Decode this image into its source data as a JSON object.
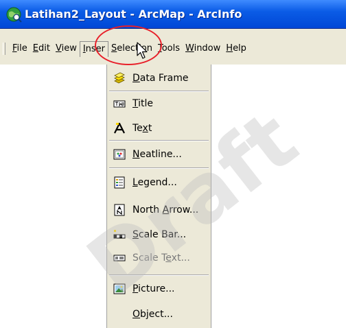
{
  "window": {
    "title": "Latihan2_Layout - ArcMap - ArcInfo"
  },
  "menubar": [
    {
      "label": "File",
      "mnemonic_index": 0
    },
    {
      "label": "Edit",
      "mnemonic_index": 0
    },
    {
      "label": "View",
      "mnemonic_index": 0
    },
    {
      "label": "Inser",
      "mnemonic_index": 0
    },
    {
      "label": "Selection",
      "mnemonic_index": 0
    },
    {
      "label": "Tools",
      "mnemonic_index": 0
    },
    {
      "label": "Window",
      "mnemonic_index": 0
    },
    {
      "label": "Help",
      "mnemonic_index": 0
    }
  ],
  "active_menu": "Inser",
  "insert_menu": {
    "items": [
      {
        "label": "Data Frame",
        "mnemonic_index": 0,
        "icon": "data-frame-icon",
        "enabled": true
      },
      {
        "label": "Title",
        "mnemonic_index": 0,
        "icon": "title-icon",
        "enabled": true
      },
      {
        "label": "Text",
        "mnemonic_index": 2,
        "icon": "text-icon",
        "enabled": true
      },
      {
        "label": "Neatline...",
        "mnemonic_index": 0,
        "icon": "neatline-icon",
        "enabled": true
      },
      {
        "label": "Legend...",
        "mnemonic_index": 0,
        "icon": "legend-icon",
        "enabled": true
      },
      {
        "label": "North Arrow...",
        "mnemonic_index": 6,
        "icon": "north-arrow-icon",
        "enabled": true
      },
      {
        "label": "Scale Bar...",
        "mnemonic_index": 0,
        "icon": "scale-bar-icon",
        "enabled": true
      },
      {
        "label": "Scale Text...",
        "mnemonic_index": 7,
        "icon": "scale-text-icon",
        "enabled": false
      },
      {
        "label": "Picture...",
        "mnemonic_index": 0,
        "icon": "picture-icon",
        "enabled": true
      },
      {
        "label": "Object...",
        "mnemonic_index": 0,
        "icon": "",
        "enabled": true
      }
    ]
  },
  "watermark": {
    "text": "Draft"
  },
  "colors": {
    "titlebar": "#0b5ce6",
    "menu_bg": "#ece9d8",
    "highlight_ring": "#e8202a",
    "disabled_text": "#7a7a7a"
  }
}
